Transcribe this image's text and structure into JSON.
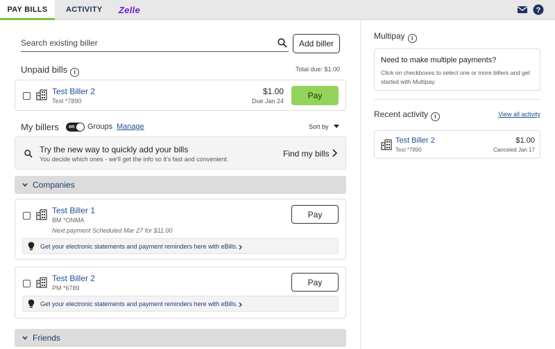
{
  "nav": {
    "tabs": [
      {
        "label": "PAY BILLS"
      },
      {
        "label": "ACTIVITY"
      }
    ],
    "zelle_label": "Zelle"
  },
  "search": {
    "placeholder": "Search existing biller",
    "add_label": "Add biller"
  },
  "unpaid": {
    "title": "Unpaid bills",
    "total_due": "Total due: $1.00",
    "bill": {
      "name": "Test Biller 2",
      "account": "Test *7890",
      "amount": "$1.00",
      "due": "Due Jan 24",
      "pay_label": "Pay"
    }
  },
  "my_billers": {
    "title": "My billers",
    "toggle_on": "on",
    "groups_label": "Groups",
    "manage_label": "Manage",
    "sort_label": "Sort by"
  },
  "banner": {
    "title": "Try the new way to quickly add your bills",
    "subtitle": "You decide which ones - we'll get the info so it's fast and convenient.",
    "action": "Find my bills"
  },
  "companies": {
    "label": "Companies",
    "billers": [
      {
        "name": "Test Biller 1",
        "account": "BM *ONMA",
        "next_prefix": "Next payment Scheduled ",
        "next_date": "Mar 27",
        "next_mid": " for ",
        "next_amount": "$11.00",
        "pay_label": "Pay",
        "ebill": "Get your electronic statements and payment reminders here with eBills."
      },
      {
        "name": "Test Biller 2",
        "account": "PM *6789",
        "pay_label": "Pay",
        "ebill": "Get your electronic statements and payment reminders here with eBills."
      }
    ]
  },
  "friends": {
    "label": "Friends"
  },
  "multipay": {
    "title": "Multipay",
    "heading": "Need to make multiple payments?",
    "body": "Click on checkboxes to select one or more billers and get started with Multipay."
  },
  "recent": {
    "title": "Recent activity",
    "view_all": "View all activity",
    "item": {
      "name": "Test Biller 2",
      "account": "Test *7890",
      "amount": "$1.00",
      "status": "Canceled Jan 17"
    }
  },
  "colors": {
    "accent_green": "#93d35b",
    "tab_underline": "#7bc142",
    "link_blue": "#1d4f91",
    "zelle_purple": "#6d1ed4"
  }
}
